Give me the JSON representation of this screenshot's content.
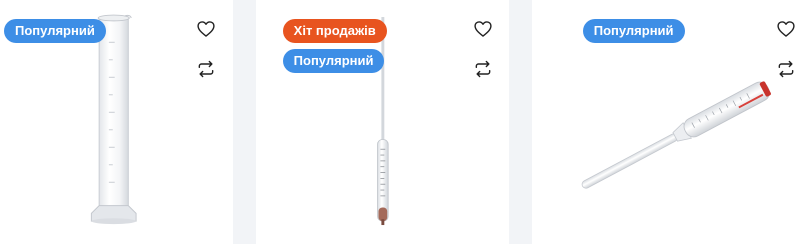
{
  "products": [
    {
      "badges": [
        {
          "label": "Популярний",
          "kind": "popular"
        }
      ],
      "image_icon": "graduated-cylinder"
    },
    {
      "badges": [
        {
          "label": "Хіт продажів",
          "kind": "hit"
        },
        {
          "label": "Популярний",
          "kind": "popular"
        }
      ],
      "image_icon": "hydrometer"
    },
    {
      "badges": [
        {
          "label": "Популярний",
          "kind": "popular"
        }
      ],
      "image_icon": "alcoholmeter"
    }
  ],
  "actions": {
    "wishlist_icon": "heart-icon",
    "compare_icon": "compare-arrows-icon"
  },
  "colors": {
    "popular_badge": "#3d8ee6",
    "hit_badge": "#e8541f",
    "gutter": "#f2f4f7",
    "icon": "#222222"
  }
}
